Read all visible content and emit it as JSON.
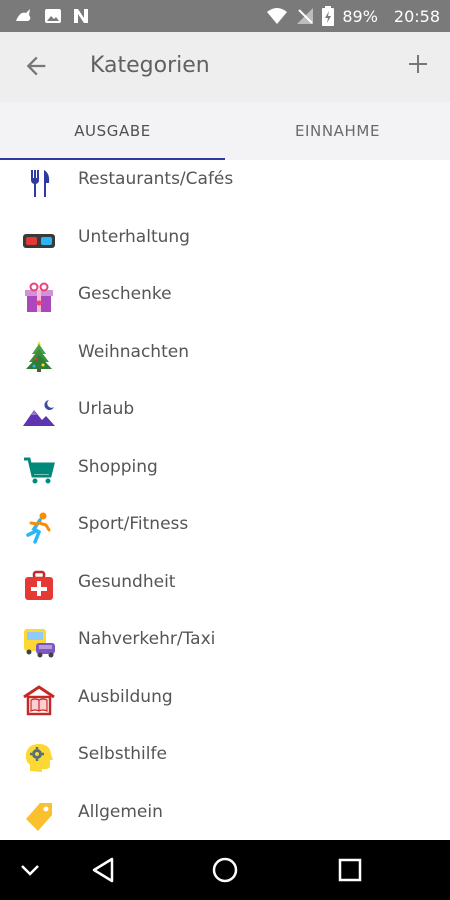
{
  "status": {
    "battery": "89%",
    "time": "20:58"
  },
  "header": {
    "title": "Kategorien"
  },
  "tabs": [
    {
      "label": "AUSGABE"
    },
    {
      "label": "EINNAHME"
    }
  ],
  "categories": [
    {
      "label": "Restaurants/Cafés",
      "icon": "cutlery-icon"
    },
    {
      "label": "Unterhaltung",
      "icon": "3d-glasses-icon"
    },
    {
      "label": "Geschenke",
      "icon": "gift-icon"
    },
    {
      "label": "Weihnachten",
      "icon": "christmas-tree-icon"
    },
    {
      "label": "Urlaub",
      "icon": "mountain-moon-icon"
    },
    {
      "label": "Shopping",
      "icon": "shopping-cart-icon"
    },
    {
      "label": "Sport/Fitness",
      "icon": "runner-icon"
    },
    {
      "label": "Gesundheit",
      "icon": "first-aid-icon"
    },
    {
      "label": "Nahverkehr/Taxi",
      "icon": "bus-taxi-icon"
    },
    {
      "label": "Ausbildung",
      "icon": "school-book-icon"
    },
    {
      "label": "Selbsthilfe",
      "icon": "head-gear-icon"
    },
    {
      "label": "Allgemein",
      "icon": "tag-icon"
    }
  ],
  "colors": {
    "accent": "#2f3aa1",
    "appbar": "#eeeeef",
    "statusbar": "#7a7a7a"
  }
}
